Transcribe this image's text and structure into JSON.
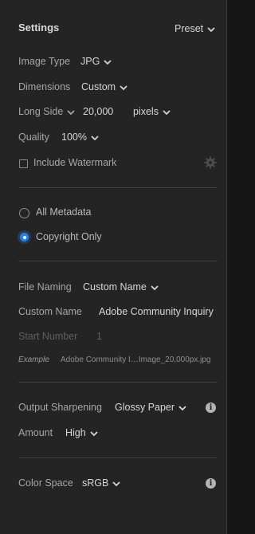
{
  "header": {
    "title": "Settings",
    "preset_label": "Preset"
  },
  "image": {
    "type_label": "Image Type",
    "type_value": "JPG",
    "dimensions_label": "Dimensions",
    "dimensions_value": "Custom",
    "long_side_label": "Long Side",
    "long_side_value": "20,000",
    "unit_value": "pixels",
    "quality_label": "Quality",
    "quality_value": "100%",
    "watermark_label": "Include Watermark",
    "watermark_checked": false
  },
  "metadata": {
    "options": [
      {
        "label": "All Metadata",
        "selected": false
      },
      {
        "label": "Copyright Only",
        "selected": true
      }
    ]
  },
  "naming": {
    "file_naming_label": "File Naming",
    "file_naming_value": "Custom Name",
    "custom_name_label": "Custom Name",
    "custom_name_value": "Adobe Community Inquiry",
    "start_number_label": "Start Number",
    "start_number_value": "1",
    "example_label": "Example",
    "example_value": "Adobe Community I…Image_20,000px.jpg"
  },
  "sharpening": {
    "output_label": "Output Sharpening",
    "output_value": "Glossy Paper",
    "amount_label": "Amount",
    "amount_value": "High"
  },
  "color": {
    "space_label": "Color Space",
    "space_value": "sRGB"
  },
  "icons": {
    "chevron": "chevron-down-icon",
    "info": "info-icon",
    "gear": "gear-icon"
  },
  "colors": {
    "accent": "#2680eb",
    "panel": "#242424",
    "text": "#d6d6d6",
    "label": "#a6a6a6"
  }
}
